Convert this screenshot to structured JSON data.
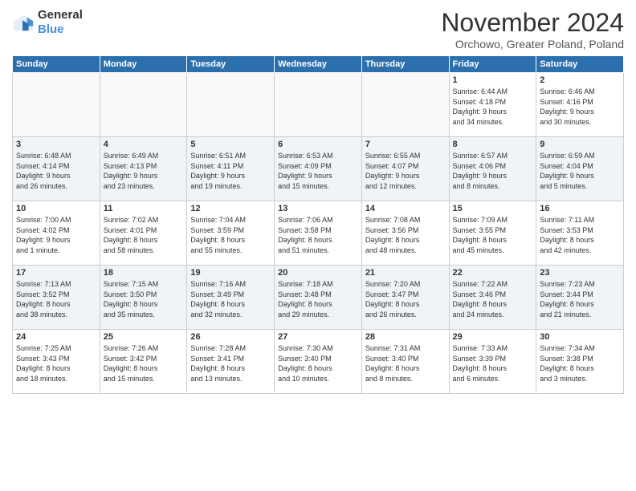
{
  "logo": {
    "line1": "General",
    "line2": "Blue"
  },
  "title": "November 2024",
  "location": "Orchowo, Greater Poland, Poland",
  "headers": [
    "Sunday",
    "Monday",
    "Tuesday",
    "Wednesday",
    "Thursday",
    "Friday",
    "Saturday"
  ],
  "weeks": [
    [
      {
        "day": "",
        "info": ""
      },
      {
        "day": "",
        "info": ""
      },
      {
        "day": "",
        "info": ""
      },
      {
        "day": "",
        "info": ""
      },
      {
        "day": "",
        "info": ""
      },
      {
        "day": "1",
        "info": "Sunrise: 6:44 AM\nSunset: 4:18 PM\nDaylight: 9 hours\nand 34 minutes."
      },
      {
        "day": "2",
        "info": "Sunrise: 6:46 AM\nSunset: 4:16 PM\nDaylight: 9 hours\nand 30 minutes."
      }
    ],
    [
      {
        "day": "3",
        "info": "Sunrise: 6:48 AM\nSunset: 4:14 PM\nDaylight: 9 hours\nand 26 minutes."
      },
      {
        "day": "4",
        "info": "Sunrise: 6:49 AM\nSunset: 4:13 PM\nDaylight: 9 hours\nand 23 minutes."
      },
      {
        "day": "5",
        "info": "Sunrise: 6:51 AM\nSunset: 4:11 PM\nDaylight: 9 hours\nand 19 minutes."
      },
      {
        "day": "6",
        "info": "Sunrise: 6:53 AM\nSunset: 4:09 PM\nDaylight: 9 hours\nand 15 minutes."
      },
      {
        "day": "7",
        "info": "Sunrise: 6:55 AM\nSunset: 4:07 PM\nDaylight: 9 hours\nand 12 minutes."
      },
      {
        "day": "8",
        "info": "Sunrise: 6:57 AM\nSunset: 4:06 PM\nDaylight: 9 hours\nand 8 minutes."
      },
      {
        "day": "9",
        "info": "Sunrise: 6:59 AM\nSunset: 4:04 PM\nDaylight: 9 hours\nand 5 minutes."
      }
    ],
    [
      {
        "day": "10",
        "info": "Sunrise: 7:00 AM\nSunset: 4:02 PM\nDaylight: 9 hours\nand 1 minute."
      },
      {
        "day": "11",
        "info": "Sunrise: 7:02 AM\nSunset: 4:01 PM\nDaylight: 8 hours\nand 58 minutes."
      },
      {
        "day": "12",
        "info": "Sunrise: 7:04 AM\nSunset: 3:59 PM\nDaylight: 8 hours\nand 55 minutes."
      },
      {
        "day": "13",
        "info": "Sunrise: 7:06 AM\nSunset: 3:58 PM\nDaylight: 8 hours\nand 51 minutes."
      },
      {
        "day": "14",
        "info": "Sunrise: 7:08 AM\nSunset: 3:56 PM\nDaylight: 8 hours\nand 48 minutes."
      },
      {
        "day": "15",
        "info": "Sunrise: 7:09 AM\nSunset: 3:55 PM\nDaylight: 8 hours\nand 45 minutes."
      },
      {
        "day": "16",
        "info": "Sunrise: 7:11 AM\nSunset: 3:53 PM\nDaylight: 8 hours\nand 42 minutes."
      }
    ],
    [
      {
        "day": "17",
        "info": "Sunrise: 7:13 AM\nSunset: 3:52 PM\nDaylight: 8 hours\nand 38 minutes."
      },
      {
        "day": "18",
        "info": "Sunrise: 7:15 AM\nSunset: 3:50 PM\nDaylight: 8 hours\nand 35 minutes."
      },
      {
        "day": "19",
        "info": "Sunrise: 7:16 AM\nSunset: 3:49 PM\nDaylight: 8 hours\nand 32 minutes."
      },
      {
        "day": "20",
        "info": "Sunrise: 7:18 AM\nSunset: 3:48 PM\nDaylight: 8 hours\nand 29 minutes."
      },
      {
        "day": "21",
        "info": "Sunrise: 7:20 AM\nSunset: 3:47 PM\nDaylight: 8 hours\nand 26 minutes."
      },
      {
        "day": "22",
        "info": "Sunrise: 7:22 AM\nSunset: 3:46 PM\nDaylight: 8 hours\nand 24 minutes."
      },
      {
        "day": "23",
        "info": "Sunrise: 7:23 AM\nSunset: 3:44 PM\nDaylight: 8 hours\nand 21 minutes."
      }
    ],
    [
      {
        "day": "24",
        "info": "Sunrise: 7:25 AM\nSunset: 3:43 PM\nDaylight: 8 hours\nand 18 minutes."
      },
      {
        "day": "25",
        "info": "Sunrise: 7:26 AM\nSunset: 3:42 PM\nDaylight: 8 hours\nand 15 minutes."
      },
      {
        "day": "26",
        "info": "Sunrise: 7:28 AM\nSunset: 3:41 PM\nDaylight: 8 hours\nand 13 minutes."
      },
      {
        "day": "27",
        "info": "Sunrise: 7:30 AM\nSunset: 3:40 PM\nDaylight: 8 hours\nand 10 minutes."
      },
      {
        "day": "28",
        "info": "Sunrise: 7:31 AM\nSunset: 3:40 PM\nDaylight: 8 hours\nand 8 minutes."
      },
      {
        "day": "29",
        "info": "Sunrise: 7:33 AM\nSunset: 3:39 PM\nDaylight: 8 hours\nand 6 minutes."
      },
      {
        "day": "30",
        "info": "Sunrise: 7:34 AM\nSunset: 3:38 PM\nDaylight: 8 hours\nand 3 minutes."
      }
    ]
  ]
}
